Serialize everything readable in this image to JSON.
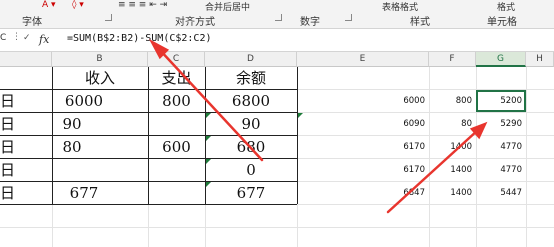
{
  "ribbon": {
    "groups": [
      "字体",
      "对齐方式",
      "数字",
      "样式",
      "单元格"
    ],
    "table_format": "表格格式",
    "format": "格式",
    "merge_center": "合并后居中"
  },
  "formula_bar": {
    "cell_ref": "C",
    "fx": "fx",
    "formula": "=SUM(B$2:B2)-SUM(C$2:C2)"
  },
  "columns": [
    "B",
    "C",
    "D",
    "E",
    "F",
    "G",
    "H"
  ],
  "selected_column": "G",
  "table": {
    "headers": [
      "收入",
      "支出",
      "余额"
    ],
    "row_label": "日",
    "rows": [
      {
        "income": "6000",
        "expense": "800",
        "balance": "6800"
      },
      {
        "income": "90",
        "expense": "",
        "balance": "90"
      },
      {
        "income": "80",
        "expense": "600",
        "balance": "680"
      },
      {
        "income": "",
        "expense": "",
        "balance": "0"
      },
      {
        "income": "677",
        "expense": "",
        "balance": "677"
      }
    ]
  },
  "right_table": [
    [
      "6000",
      "800",
      "5200"
    ],
    [
      "6090",
      "80",
      "5290"
    ],
    [
      "6170",
      "1400",
      "4770"
    ],
    [
      "6170",
      "1400",
      "4770"
    ],
    [
      "6847",
      "1400",
      "5447"
    ]
  ],
  "annotation_color": "#e8352e"
}
